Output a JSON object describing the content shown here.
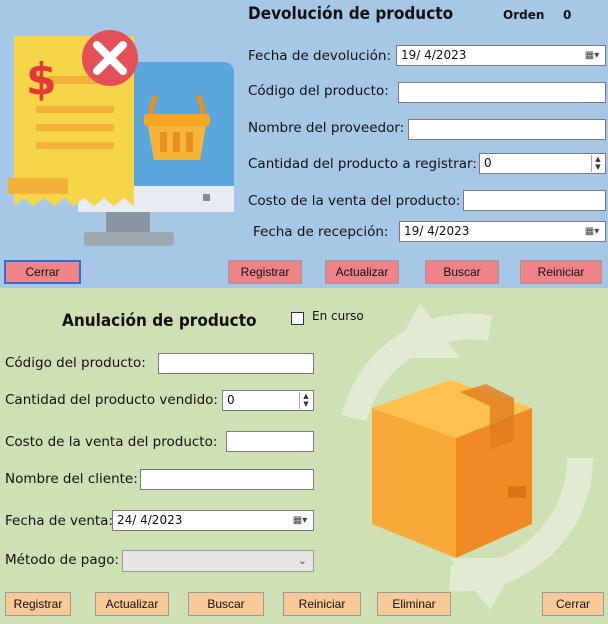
{
  "devolucion": {
    "title": "Devolución de producto",
    "orden_label": "Orden",
    "orden_value": "0",
    "fecha_devolucion_label": "Fecha de devolución:",
    "fecha_devolucion_value": "19/ 4/2023",
    "codigo_label": "Código del producto:",
    "codigo_value": "",
    "proveedor_label": "Nombre del proveedor:",
    "proveedor_value": "",
    "cantidad_label": "Cantidad del producto a registrar:",
    "cantidad_value": "0",
    "costo_label": "Costo de la venta del producto:",
    "costo_value": "",
    "fecha_recepcion_label": "Fecha de recepción:",
    "fecha_recepcion_value": "19/ 4/2023",
    "buttons": {
      "cerrar": "Cerrar",
      "registrar": "Registrar",
      "actualizar": "Actualizar",
      "buscar": "Buscar",
      "reiniciar": "Reiniciar"
    }
  },
  "anulacion": {
    "title": "Anulación de producto",
    "en_curso_label": "En curso",
    "codigo_label": "Código del producto:",
    "codigo_value": "",
    "cantidad_label": "Cantidad del producto vendido:",
    "cantidad_value": "0",
    "costo_label": "Costo de la venta del producto:",
    "costo_value": "",
    "cliente_label": "Nombre del cliente:",
    "cliente_value": "",
    "fecha_venta_label": "Fecha de venta:",
    "fecha_venta_value": "24/ 4/2023",
    "metodo_label": "Método de pago:",
    "metodo_value": "",
    "buttons": {
      "registrar": "Registrar",
      "actualizar": "Actualizar",
      "buscar": "Buscar",
      "reiniciar": "Reiniciar",
      "eliminar": "Eliminar",
      "cerrar": "Cerrar"
    }
  },
  "icons": {
    "refund": "invoice-cancel-monitor-icon",
    "box": "cardboard-box-icon",
    "cycle": "circular-arrows-icon",
    "calendar": "calendar-dropdown-icon",
    "spinner": "numeric-spinner-icon"
  },
  "colors": {
    "top_bg": "#a6c8e6",
    "bottom_bg": "#cfe0b4",
    "red_button": "#ee8388",
    "orange_button": "#f7c999"
  }
}
